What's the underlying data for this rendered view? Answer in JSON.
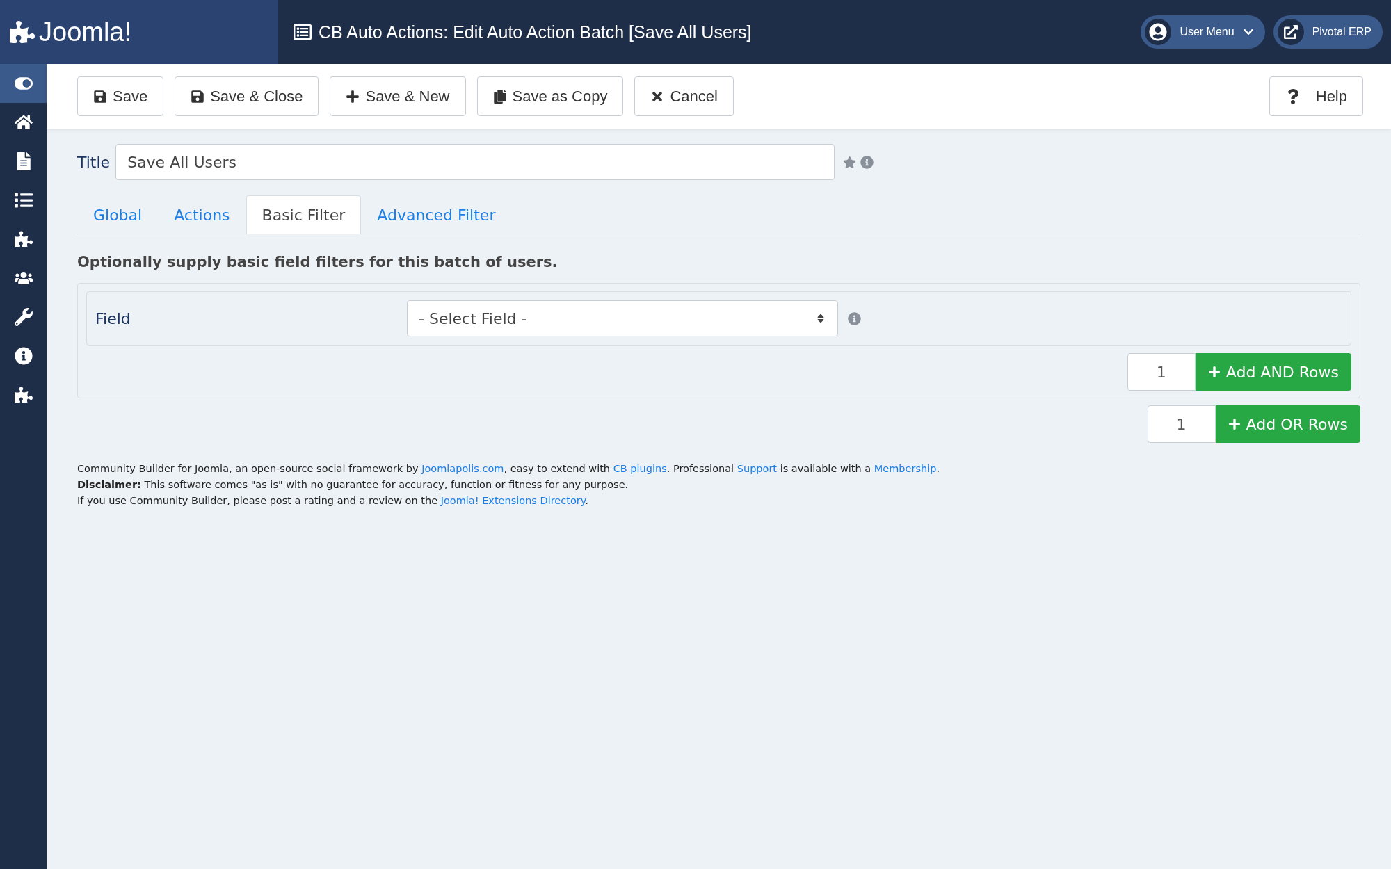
{
  "header": {
    "logo_text": "Joomla!",
    "title": "CB Auto Actions: Edit Auto Action Batch [Save All Users]",
    "user_menu": "User Menu",
    "site_link": "Pivotal ERP"
  },
  "sidebar": {
    "items": [
      {
        "kind": "toggle",
        "selected": true
      },
      {
        "kind": "home",
        "selected": false
      },
      {
        "kind": "file",
        "selected": false
      },
      {
        "kind": "list",
        "selected": false
      },
      {
        "kind": "puzzle",
        "selected": false
      },
      {
        "kind": "users",
        "selected": false
      },
      {
        "kind": "wrench",
        "selected": false
      },
      {
        "kind": "info",
        "selected": false
      },
      {
        "kind": "puzzle",
        "selected": false
      }
    ]
  },
  "toolbar": {
    "buttons": [
      {
        "kind": "save",
        "label": "Save"
      },
      {
        "kind": "save",
        "label": "Save & Close"
      },
      {
        "kind": "plus",
        "label": "Save & New"
      },
      {
        "kind": "copy",
        "label": "Save as Copy"
      },
      {
        "kind": "cancel",
        "label": "Cancel"
      }
    ],
    "help": "Help"
  },
  "title_field": {
    "label": "Title",
    "value": "Save All Users"
  },
  "tabs": [
    {
      "label": "Global",
      "selected": false
    },
    {
      "label": "Actions",
      "selected": false
    },
    {
      "label": "Basic Filter",
      "selected": true
    },
    {
      "label": "Advanced Filter",
      "selected": false
    }
  ],
  "intro": "Optionally supply basic field filters for this batch of users.",
  "filter": {
    "field_label": "Field",
    "select_value": "- Select Field -",
    "and_count": "1",
    "and_button": "Add AND Rows",
    "or_count": "1",
    "or_button": "Add OR Rows"
  },
  "footer": [
    [
      {
        "text": "Community Builder for Joomla, an open-source social framework by ",
        "link": false
      },
      {
        "text": "Joomlapolis.com",
        "link": true
      },
      {
        "text": ", easy to extend with ",
        "link": false
      },
      {
        "text": "CB plugins",
        "link": true
      },
      {
        "text": ". Professional ",
        "link": false
      },
      {
        "text": "Support",
        "link": true
      },
      {
        "text": " is available with a ",
        "link": false
      },
      {
        "text": "Membership",
        "link": true
      },
      {
        "text": ".",
        "link": false
      }
    ],
    [
      {
        "text": "**Disclaimer:** This software comes \"as is\" with no guarantee for accuracy, function or fitness for any purpose.",
        "link": false
      }
    ],
    [
      {
        "text": "If you use Community Builder, please post a rating and a review on the ",
        "link": false
      },
      {
        "text": "Joomla! Extensions Directory",
        "link": true
      },
      {
        "text": ".",
        "link": false
      }
    ]
  ]
}
